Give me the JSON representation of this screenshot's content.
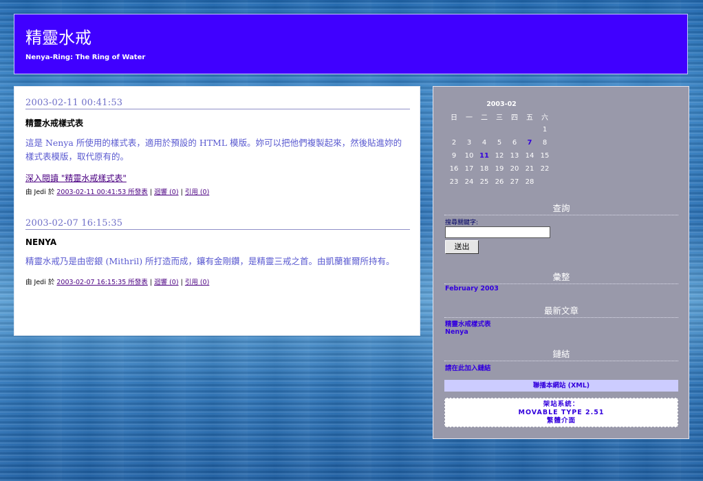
{
  "header": {
    "title": "精靈水戒",
    "description": "Nenya-Ring: The Ring of Water"
  },
  "entries": [
    {
      "date": "2003-02-11 00:41:53",
      "title": "精靈水戒樣式表",
      "body": "這是 Nenya 所使用的樣式表，適用於預設的 HTML 模版。妳可以把他們複製起來，然後貼進妳的樣式表模版，取代原有的。",
      "read_more": "深入閱讀 \"精靈水戒樣式表\"",
      "author_prefix": "由 Jedi 於",
      "permalink": "2003-02-11 00:41:53 所發表",
      "comments": "迴響 (0)",
      "trackback": "引用 (0)"
    },
    {
      "date": "2003-02-07 16:15:35",
      "title": "NENYA",
      "body": "精靈水戒乃是由密銀 (Mithril) 所打造而成，鑲有金剛鑽，是精靈三戒之首。由凱蘭崔爾所持有。",
      "author_prefix": "由 Jedi 於",
      "permalink": "2003-02-07 16:15:35 所發表",
      "comments": "迴響 (0)",
      "trackback": "引用 (0)"
    }
  ],
  "separator": "|",
  "calendar": {
    "caption": "2003-02",
    "weekdays": [
      "日",
      "一",
      "二",
      "三",
      "四",
      "五",
      "六"
    ],
    "weeks": [
      [
        "",
        "",
        "",
        "",
        "",
        "",
        "1"
      ],
      [
        "2",
        "3",
        "4",
        "5",
        "6",
        "7",
        "8"
      ],
      [
        "9",
        "10",
        "11",
        "12",
        "13",
        "14",
        "15"
      ],
      [
        "16",
        "17",
        "18",
        "19",
        "20",
        "21",
        "22"
      ],
      [
        "23",
        "24",
        "25",
        "26",
        "27",
        "28",
        ""
      ]
    ],
    "linked_days": [
      "7",
      "11"
    ]
  },
  "sidebar": {
    "search_title": "查詢",
    "search_label": "搜尋關鍵字:",
    "search_value": "",
    "search_button": "送出",
    "archives_title": "彙整",
    "archives": [
      "February 2003"
    ],
    "recent_title": "最新文章",
    "recent": [
      "精靈水戒樣式表",
      "Nenya"
    ],
    "links_title": "鏈結",
    "links": [
      "請在此加入鏈結"
    ],
    "syndicate": "聯播本網站 (XML)",
    "powered_line1": "架站系統：",
    "powered_line2": "MOVABLE TYPE 2.51",
    "powered_line3": "繁體介面"
  }
}
